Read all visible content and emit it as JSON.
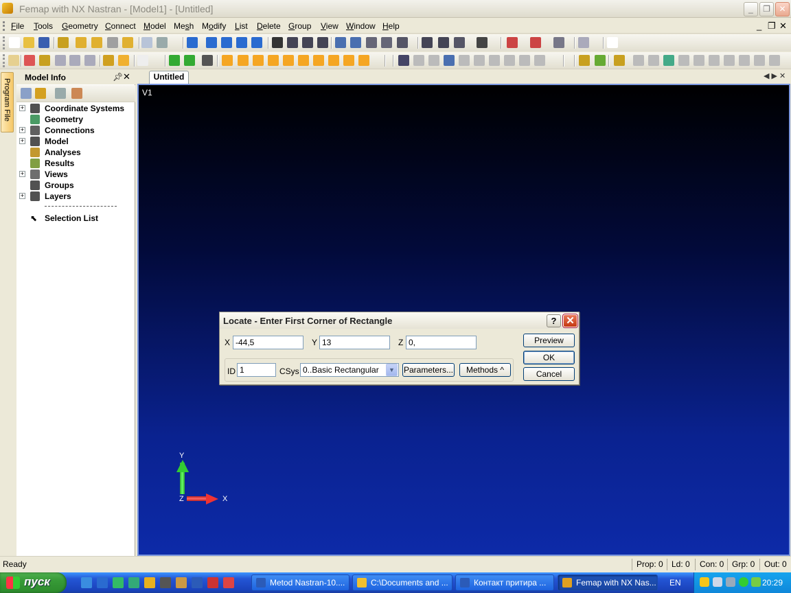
{
  "window": {
    "title": "Femap with NX Nastran - [Model1] - [Untitled]"
  },
  "menu": {
    "items": [
      {
        "pre": "",
        "u": "F",
        "post": "ile"
      },
      {
        "pre": "",
        "u": "T",
        "post": "ools"
      },
      {
        "pre": "",
        "u": "G",
        "post": "eometry"
      },
      {
        "pre": "",
        "u": "C",
        "post": "onnect"
      },
      {
        "pre": "",
        "u": "M",
        "post": "odel"
      },
      {
        "pre": "Me",
        "u": "s",
        "post": "h"
      },
      {
        "pre": "M",
        "u": "o",
        "post": "dify"
      },
      {
        "pre": "",
        "u": "L",
        "post": "ist"
      },
      {
        "pre": "",
        "u": "D",
        "post": "elete"
      },
      {
        "pre": "",
        "u": "G",
        "post": "roup"
      },
      {
        "pre": "",
        "u": "V",
        "post": "iew"
      },
      {
        "pre": "",
        "u": "W",
        "post": "indow"
      },
      {
        "pre": "",
        "u": "H",
        "post": "elp"
      }
    ]
  },
  "side_tab": {
    "label": "Program File"
  },
  "model_info": {
    "title": "Model Info",
    "tree": [
      {
        "label": "Coordinate Systems",
        "expandable": true,
        "icon": "coordinate-systems-icon"
      },
      {
        "label": "Geometry",
        "expandable": false,
        "icon": "geometry-icon"
      },
      {
        "label": "Connections",
        "expandable": true,
        "icon": "connections-icon"
      },
      {
        "label": "Model",
        "expandable": true,
        "icon": "model-icon"
      },
      {
        "label": "Analyses",
        "expandable": false,
        "icon": "analyses-icon"
      },
      {
        "label": "Results",
        "expandable": false,
        "icon": "results-icon"
      },
      {
        "label": "Views",
        "expandable": true,
        "icon": "views-icon"
      },
      {
        "label": "Groups",
        "expandable": false,
        "icon": "groups-icon"
      },
      {
        "label": "Layers",
        "expandable": true,
        "icon": "layers-icon"
      }
    ],
    "selection_list": "Selection List"
  },
  "viewport": {
    "tab": "Untitled",
    "view_label": "V1",
    "triad": {
      "x": "X",
      "y": "Y",
      "z": "Z"
    }
  },
  "dialog": {
    "title": "Locate - Enter First Corner of Rectangle",
    "help": "?",
    "x_label": "X",
    "x_value": "-44,5",
    "y_label": "Y",
    "y_value": "13",
    "z_label": "Z",
    "z_value": "0,",
    "id_label": "ID",
    "id_value": "1",
    "csys_label": "CSys",
    "csys_value": "0..Basic Rectangular",
    "parameters": "Parameters...",
    "methods": "Methods ^",
    "preview": "Preview",
    "ok": "OK",
    "cancel": "Cancel"
  },
  "status": {
    "ready": "Ready",
    "prop": "Prop: 0",
    "ld": "Ld: 0",
    "con": "Con: 0",
    "grp": "Grp: 0",
    "out": "Out: 0"
  },
  "taskbar": {
    "start": "пуск",
    "tasks": [
      {
        "label": "Metod Nastran-10....",
        "icon": "word-icon"
      },
      {
        "label": "C:\\Documents and ...",
        "icon": "folder-icon"
      },
      {
        "label": "Контакт притира ...",
        "icon": "word-icon"
      },
      {
        "label": "Femap with NX Nas...",
        "icon": "femap-icon",
        "active": true
      }
    ],
    "lang": "EN",
    "clock": "20:29"
  },
  "colors": {
    "accent": "#0a246a",
    "viewport_bottom": "#0d2aa8",
    "dialog_bg": "#ece9d8"
  }
}
